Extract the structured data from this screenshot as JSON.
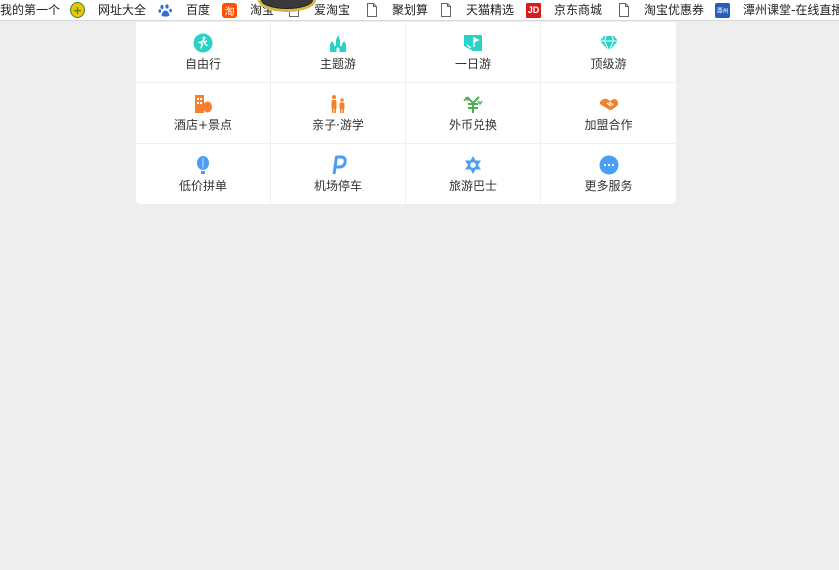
{
  "bookmarks": [
    {
      "label": "我的第一个",
      "icon": "none"
    },
    {
      "label": "网址大全",
      "icon": "360-icon"
    },
    {
      "label": "百度",
      "icon": "baidu-paw-icon"
    },
    {
      "label": "淘宝",
      "icon": "taobao-icon",
      "glyph": "淘"
    },
    {
      "label": "爱淘宝",
      "icon": "page-icon"
    },
    {
      "label": "聚划算",
      "icon": "page-icon"
    },
    {
      "label": "天猫精选",
      "icon": "page-icon"
    },
    {
      "label": "京东商城",
      "icon": "jd-icon",
      "glyph": "JD"
    },
    {
      "label": "淘宝优惠券",
      "icon": "page-icon"
    },
    {
      "label": "潭州课堂-在线直播",
      "icon": "tanzhou-icon",
      "glyph": "潭州"
    }
  ],
  "services": [
    {
      "label": "自由行",
      "icon": "hiker-icon",
      "color": "#2ad1c7"
    },
    {
      "label": "主题游",
      "icon": "castle-icon",
      "color": "#2ad1c7"
    },
    {
      "label": "一日游",
      "icon": "map-flag-icon",
      "color": "#2ad1c7"
    },
    {
      "label": "顶级游",
      "icon": "diamond-icon",
      "color": "#2ad1c7"
    },
    {
      "label": "酒店+景点",
      "icon": "hotel-icon",
      "color": "#f5822a"
    },
    {
      "label": "亲子·游学",
      "icon": "family-icon",
      "color": "#f5822a"
    },
    {
      "label": "外币兑换",
      "icon": "yen-exchange-icon",
      "color": "#4caf50"
    },
    {
      "label": "加盟合作",
      "icon": "handshake-icon",
      "color": "#f5822a"
    },
    {
      "label": "低价拼单",
      "icon": "balloon-icon",
      "color": "#4a9ff5"
    },
    {
      "label": "机场停车",
      "icon": "parking-icon",
      "color": "#4a9ff5"
    },
    {
      "label": "旅游巴士",
      "icon": "star-badge-icon",
      "color": "#4a9ff5"
    },
    {
      "label": "更多服务",
      "icon": "more-dots-icon",
      "color": "#4a9ff5"
    }
  ]
}
